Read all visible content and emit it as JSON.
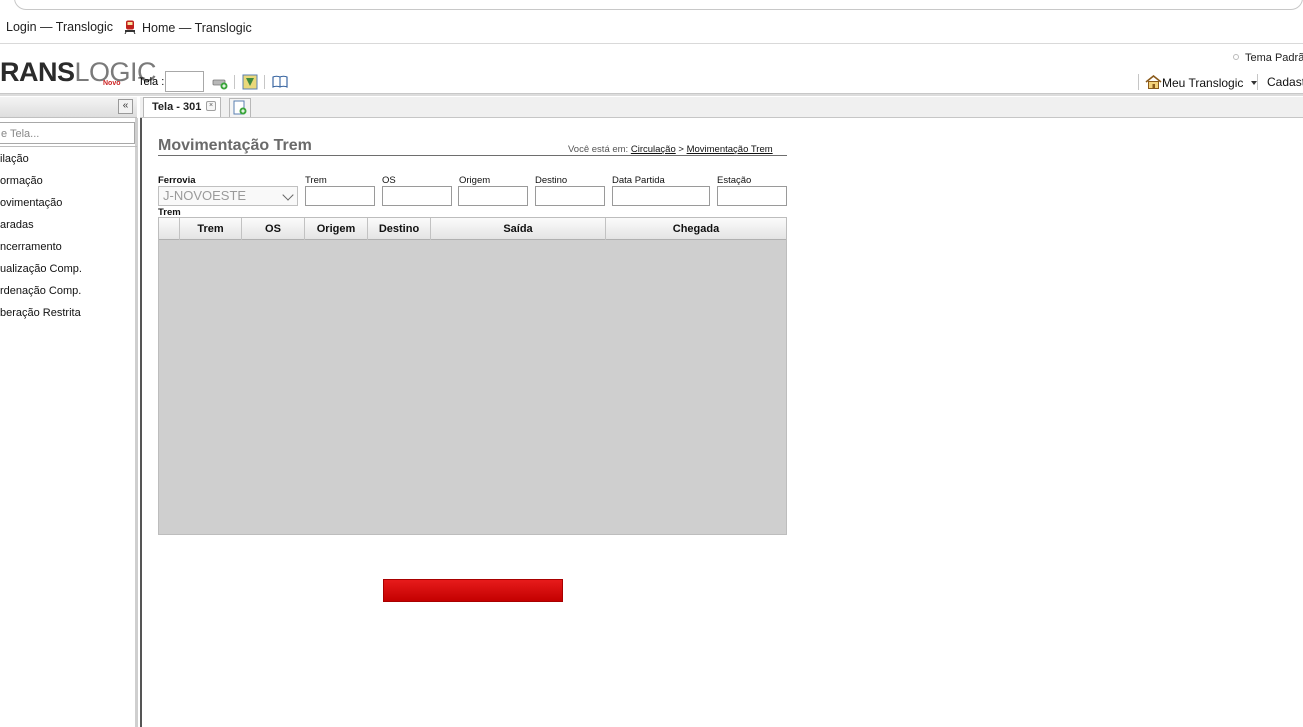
{
  "bookmarks": [
    {
      "label": "Login — Translogic"
    },
    {
      "label": "Home — Translogic"
    }
  ],
  "header": {
    "logo_bold": "RANS",
    "logo_light": "LOGIC",
    "logo_sub": "Novo",
    "tela_label": "Tela :",
    "tela_value": "",
    "tema": "Tema Padrã",
    "meu": "Meu Translogic",
    "cadastro": "Cadast"
  },
  "sidebar": {
    "search_placeholder": "e Tela...",
    "items": [
      {
        "label": "ilação"
      },
      {
        "label": "ormação"
      },
      {
        "label": "ovimentação"
      },
      {
        "label": "aradas"
      },
      {
        "label": "ncerramento"
      },
      {
        "label": "ualização Comp."
      },
      {
        "label": "rdenação Comp."
      },
      {
        "label": "beração Restrita"
      }
    ]
  },
  "tabs": [
    {
      "label": "Tela - 301"
    }
  ],
  "main": {
    "title": "Movimentação Trem",
    "breadcrumb_prefix": "Você está em:",
    "breadcrumb_1": "Circulação",
    "breadcrumb_sep": ">",
    "breadcrumb_2": "Movimentação Trem"
  },
  "filters": {
    "ferrovia_label": "Ferrovia",
    "ferrovia_value": "J-NOVOESTE",
    "trem_label": "Trem",
    "os_label": "OS",
    "origem_label": "Origem",
    "destino_label": "Destino",
    "data_partida_label": "Data Partida",
    "estacao_label": "Estação",
    "trem_value": "",
    "os_value": "",
    "origem_value": "",
    "destino_value": "",
    "data_partida_value": "",
    "estacao_value": ""
  },
  "grid": {
    "caption": "Trem",
    "columns": [
      "",
      "Trem",
      "OS",
      "Origem",
      "Destino",
      "Saída",
      "Chegada"
    ],
    "rows": []
  },
  "colors": {
    "accent_red": "#d80a0a",
    "grid_bg": "#cfcfcf",
    "title_gray": "#6a6a6a"
  }
}
